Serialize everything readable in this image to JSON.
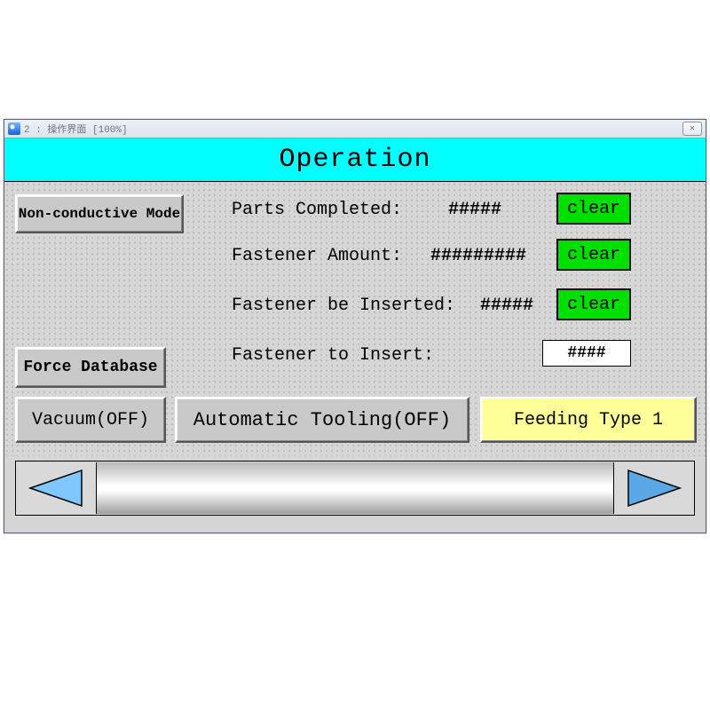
{
  "window": {
    "title": "2 : 操作界面 [100%]"
  },
  "header": {
    "title": "Operation"
  },
  "mode_button": "Non-conductive Mode",
  "db_button": "Force Database",
  "vacuum": {
    "label": "Vacuum(OFF)"
  },
  "auto_tool": {
    "label": "Automatic Tooling(OFF)"
  },
  "feed": {
    "label": "Feeding Type 1"
  },
  "rows": {
    "parts_completed": {
      "label": "Parts Completed:",
      "value": "#####",
      "clear": "clear"
    },
    "fastener_amount": {
      "label": "Fastener Amount:",
      "value": "#########",
      "clear": "clear"
    },
    "fastener_inserted": {
      "label": "Fastener be Inserted:",
      "value": "#####",
      "clear": "clear"
    },
    "fastener_to_insert": {
      "label": "Fastener to Insert:",
      "value": "####"
    }
  }
}
